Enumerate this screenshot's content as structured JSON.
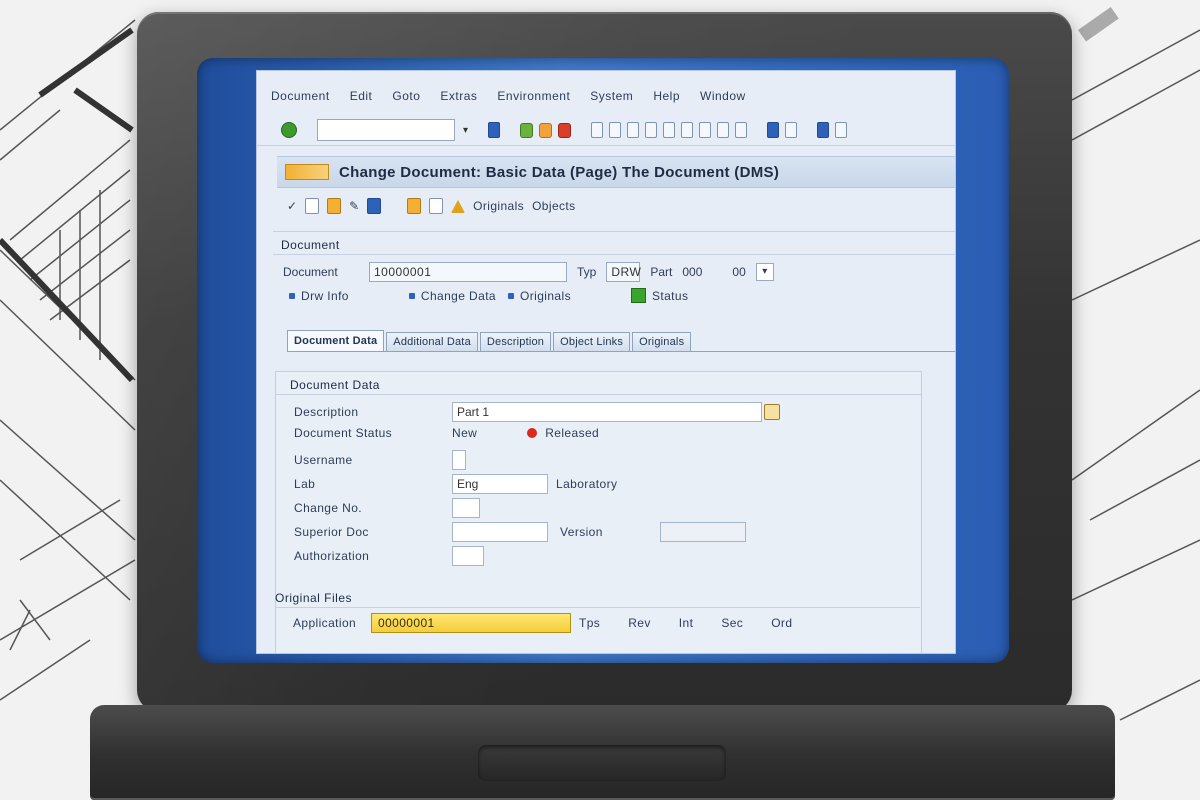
{
  "sap": {
    "menu": [
      "Document",
      "Edit",
      "Goto",
      "Extras",
      "Environment",
      "System",
      "Help",
      "Window"
    ],
    "title": "Change Document: Basic Data (Page) The Document (DMS)",
    "app_toolbar": {
      "labels": [
        "Originals",
        "Objects"
      ]
    },
    "header": {
      "section_title": "Document",
      "doc_label": "Document",
      "doc_value": "10000001",
      "type_label": "Typ",
      "type_value": "DRW",
      "part_label": "Part",
      "part_value": "000",
      "version_label": "00",
      "radio_1": "Drw Info",
      "radio_2": "Change Data",
      "radio_3": "Originals",
      "status_label": "Status"
    },
    "tabs": [
      "Document Data",
      "Additional Data",
      "Description",
      "Object Links",
      "Originals"
    ],
    "panel": {
      "title": "Document Data",
      "fields": [
        {
          "label": "Description",
          "value": "Part 1"
        },
        {
          "label": "Document Status",
          "value": "New",
          "status_text": "Released"
        },
        {
          "label": "Username",
          "value": ""
        },
        {
          "label": "Lab",
          "value": "Eng",
          "extra": "Laboratory"
        },
        {
          "label": "Change No.",
          "value": ""
        },
        {
          "label": "Superior Doc",
          "value": "",
          "extra": "Version"
        },
        {
          "label": "Authorization",
          "value": ""
        }
      ],
      "group2_title": "Original Files",
      "group2_label": "Application",
      "group2_value": "00000001",
      "group2_items": [
        "Tps",
        "Rev",
        "Int",
        "Sec",
        "Ord"
      ]
    }
  }
}
